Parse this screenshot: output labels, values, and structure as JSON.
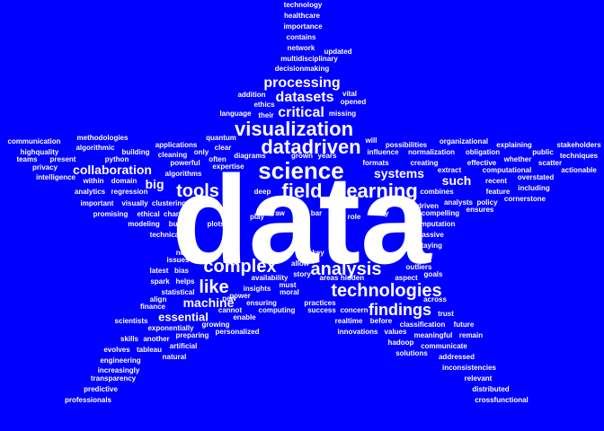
{
  "background": "#0000ff",
  "text_color": "#ffffff",
  "words": {
    "data": "data",
    "science": "science",
    "datadriven": "datadriven",
    "visualization": "visualization",
    "field": "field",
    "learning": "learning",
    "tools": "tools",
    "analysis": "analysis",
    "complex": "complex",
    "technologies": "technologies",
    "like": "like",
    "findings": "findings",
    "processing": "processing",
    "datasets": "datasets",
    "critical": "critical",
    "collaboration": "collaboration",
    "systems": "systems",
    "such": "such",
    "big": "big",
    "machine": "machine",
    "essential": "essential",
    "technology": "technology",
    "healthcare": "healthcare",
    "importance": "importance",
    "contains": "contains",
    "network": "network",
    "updated": "updated",
    "multidisciplinary": "multidisciplinary",
    "decisionmaking": "decisionmaking",
    "addition": "addition",
    "vital": "vital",
    "ethics": "ethics",
    "opened": "opened",
    "language": "language",
    "their": "their",
    "missing": "missing",
    "methodologies": "methodologies",
    "quantum": "quantum",
    "communication": "communication",
    "algorithmic": "algorithmic",
    "applications": "applications",
    "clear": "clear",
    "will": "will",
    "possibilities": "possibilities",
    "organizational": "organizational",
    "explaining": "explaining",
    "stakeholders": "stakeholders",
    "highquality": "highquality",
    "building": "building",
    "cleaning": "cleaning",
    "only": "only",
    "diagrams": "diagrams",
    "grown": "grown",
    "years": "years",
    "influence": "influence",
    "normalization": "normalization",
    "obligation": "obligation",
    "public": "public",
    "techniques": "techniques",
    "teams": "teams",
    "present": "present",
    "python": "python",
    "powerful": "powerful",
    "often": "often",
    "formats": "formats",
    "creating": "creating",
    "effective": "effective",
    "whether": "whether",
    "scatter": "scatter",
    "privacy": "privacy",
    "expertise": "expertise",
    "computational": "computational",
    "actionable": "actionable",
    "intelligence": "intelligence",
    "algorithms": "algorithms",
    "extract": "extract",
    "recent": "recent",
    "overstated": "overstated",
    "within": "within",
    "domain": "domain",
    "analytics": "analytics",
    "regression": "regression",
    "deep": "deep",
    "combines": "combines",
    "feature": "feature",
    "including": "including",
    "important": "important",
    "visually": "visually",
    "clustering": "clustering",
    "driven": "driven",
    "analysts": "analysts",
    "policy": "policy",
    "cornerstone": "cornerstone",
    "promising": "promising",
    "ethical": "ethical",
    "charts": "charts",
    "raw": "raw",
    "bar": "bar",
    "way": "way",
    "ensures": "ensures",
    "compelling": "compelling",
    "play": "play",
    "role": "role",
    "modeling": "modeling",
    "but": "but",
    "plots": "plots",
    "imputation": "imputation",
    "technical": "technical",
    "massive": "massive",
    "staying": "staying",
    "not": "not",
    "key": "key",
    "itself": "itself",
    "issues": "issues",
    "allow": "allow",
    "latest": "latest",
    "bias": "bias",
    "outliers": "outliers",
    "story": "story",
    "goals": "goals",
    "spark": "spark",
    "helps": "helps",
    "availability": "availability",
    "areas": "areas",
    "aspect": "aspect",
    "statistical": "statistical",
    "insights": "insights",
    "must": "must",
    "moral": "moral",
    "hidden": "hidden",
    "across": "across",
    "new": "new",
    "power": "power",
    "practices": "practices",
    "align": "align",
    "ensuring": "ensuring",
    "finance": "finance",
    "cannot": "cannot",
    "computing": "computing",
    "success": "success",
    "concern": "concern",
    "trust": "trust",
    "enable": "enable",
    "scientists": "scientists",
    "growing": "growing",
    "realtime": "realtime",
    "before": "before",
    "classification": "classification",
    "future": "future",
    "exponentially": "exponentially",
    "personalized": "personalized",
    "innovations": "innovations",
    "values": "values",
    "meaningful": "meaningful",
    "remain": "remain",
    "skills": "skills",
    "another": "another",
    "preparing": "preparing",
    "hadoop": "hadoop",
    "communicate": "communicate",
    "evolves": "evolves",
    "tableau": "tableau",
    "artificial": "artificial",
    "solutions": "solutions",
    "addressed": "addressed",
    "engineering": "engineering",
    "natural": "natural",
    "inconsistencies": "inconsistencies",
    "increasingly": "increasingly",
    "relevant": "relevant",
    "transparency": "transparency",
    "predictive": "predictive",
    "distributed": "distributed",
    "professionals": "professionals",
    "crossfunctional": "crossfunctional"
  }
}
